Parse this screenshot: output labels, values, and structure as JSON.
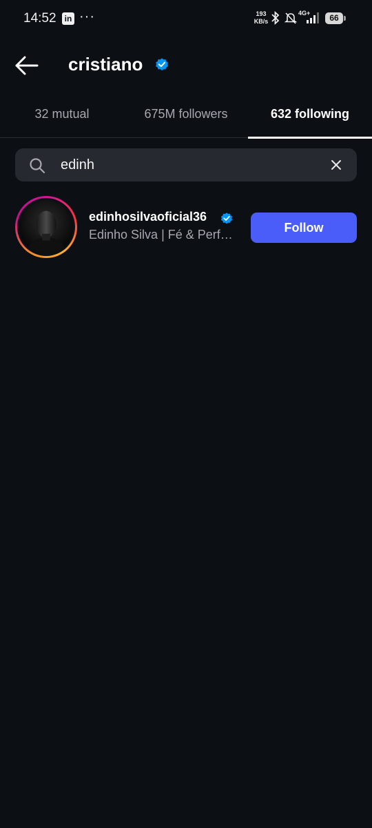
{
  "status_bar": {
    "time": "14:52",
    "notification_app": "in",
    "more_indicator": "···",
    "net_speed_value": "193",
    "net_speed_unit": "KB/s",
    "network_type": "4G+",
    "battery": "66"
  },
  "header": {
    "title": "cristiano",
    "verified": true
  },
  "tabs": [
    {
      "label": "32 mutual",
      "active": false
    },
    {
      "label": "675M followers",
      "active": false
    },
    {
      "label": "632 following",
      "active": true
    }
  ],
  "search": {
    "value": "edinh"
  },
  "results": [
    {
      "username": "edinhosilvaoficial36",
      "verified": true,
      "full_name": "Edinho Silva | Fé & Performance",
      "button_label": "Follow"
    }
  ],
  "colors": {
    "background": "#0c0f14",
    "accent": "#4a5df9",
    "verified_badge": "#0095f6"
  }
}
